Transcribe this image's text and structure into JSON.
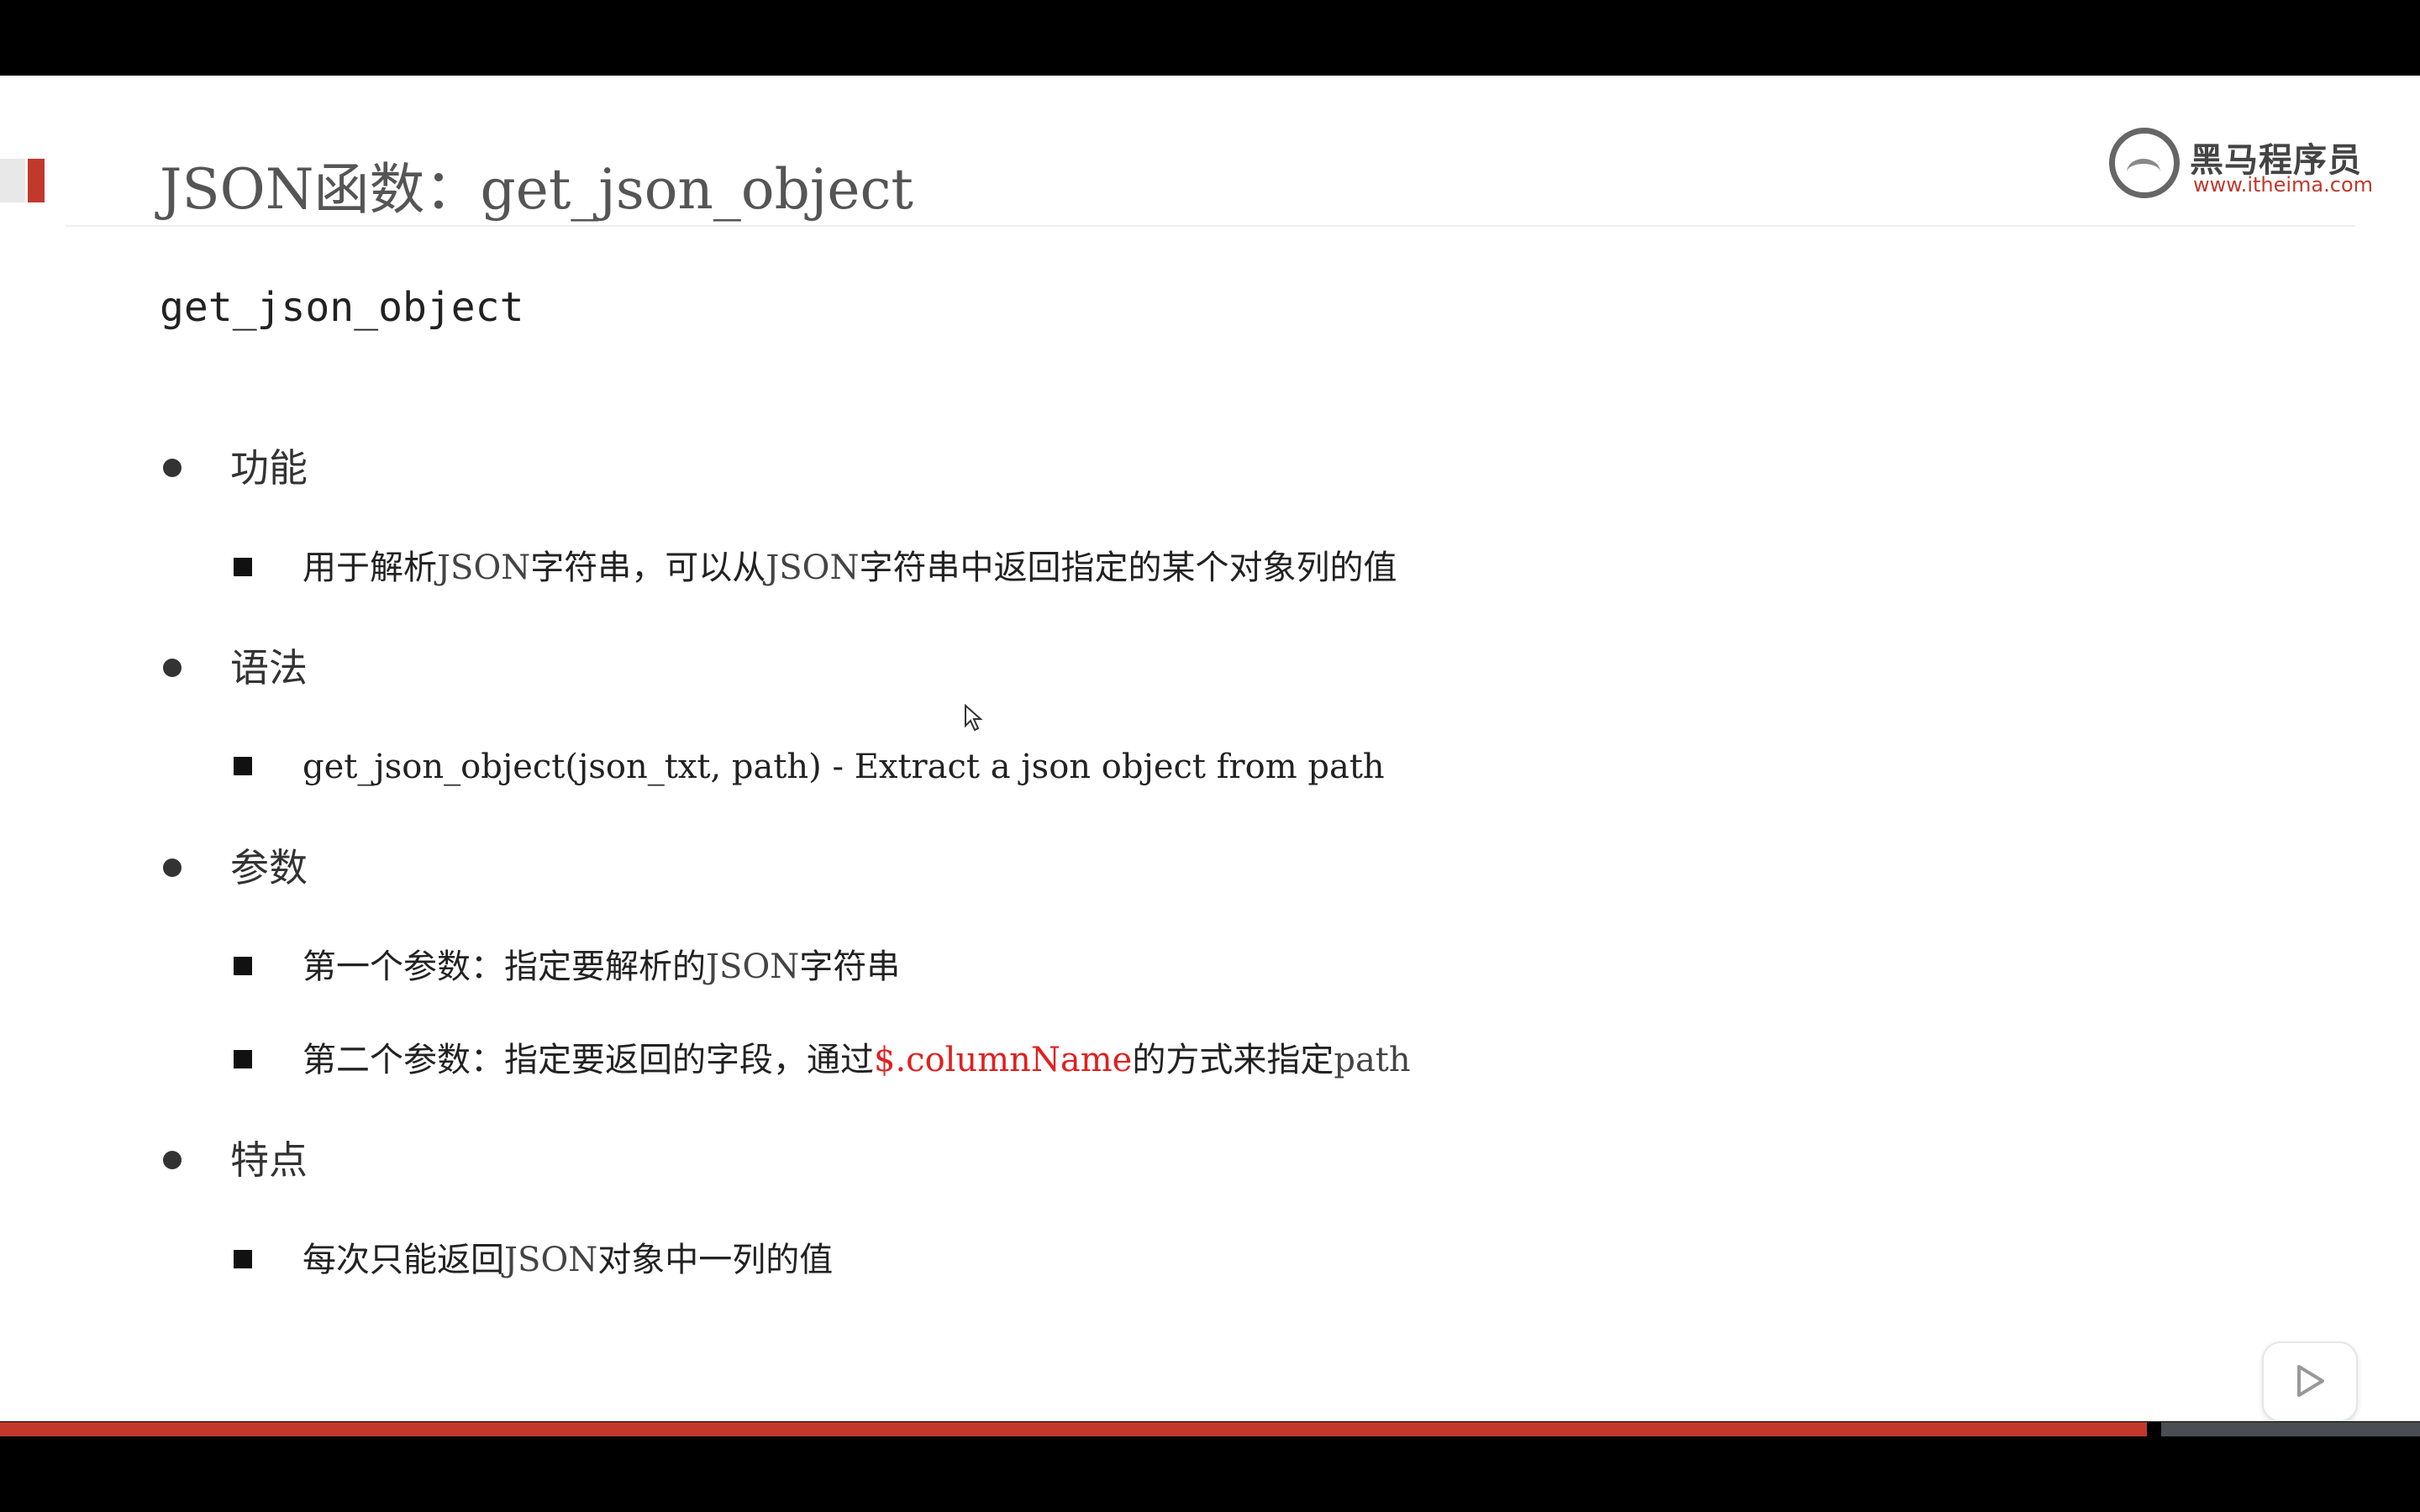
{
  "slide": {
    "title": "JSON函数：get_json_object",
    "subtitle": "get_json_object",
    "logo": {
      "name": "黑马程序员",
      "url": "www.itheima.com"
    },
    "sections": [
      {
        "heading": "功能",
        "items": [
          [
            "用于解析",
            "JSON",
            "字符串，可以从",
            "JSON",
            "字符串中返回指定的某个对象列的值"
          ]
        ]
      },
      {
        "heading": "语法",
        "items": [
          [
            "get_json_object(json_txt, path) - Extract a json object from path"
          ]
        ]
      },
      {
        "heading": "参数",
        "items": [
          [
            "第一个参数：指定要解析的",
            "JSON",
            "字符串"
          ],
          [
            "第二个参数：指定要返回的字段，通过",
            "$.columnName",
            "的方式来指定",
            "path"
          ]
        ]
      },
      {
        "heading": "特点",
        "items": [
          [
            "每次只能返回",
            "JSON",
            "对象中一列的值"
          ]
        ]
      }
    ]
  },
  "icons": {
    "cursor": "mouse-pointer-icon",
    "play": "play-icon",
    "controls": [
      "prev-icon",
      "next-icon",
      "pen-icon",
      "slides-icon",
      "zoom-icon",
      "more-icon"
    ]
  },
  "colors": {
    "accent": "#c0392b",
    "highlight": "#e02020",
    "text": "#333333"
  },
  "presentation_progress": 0.89
}
